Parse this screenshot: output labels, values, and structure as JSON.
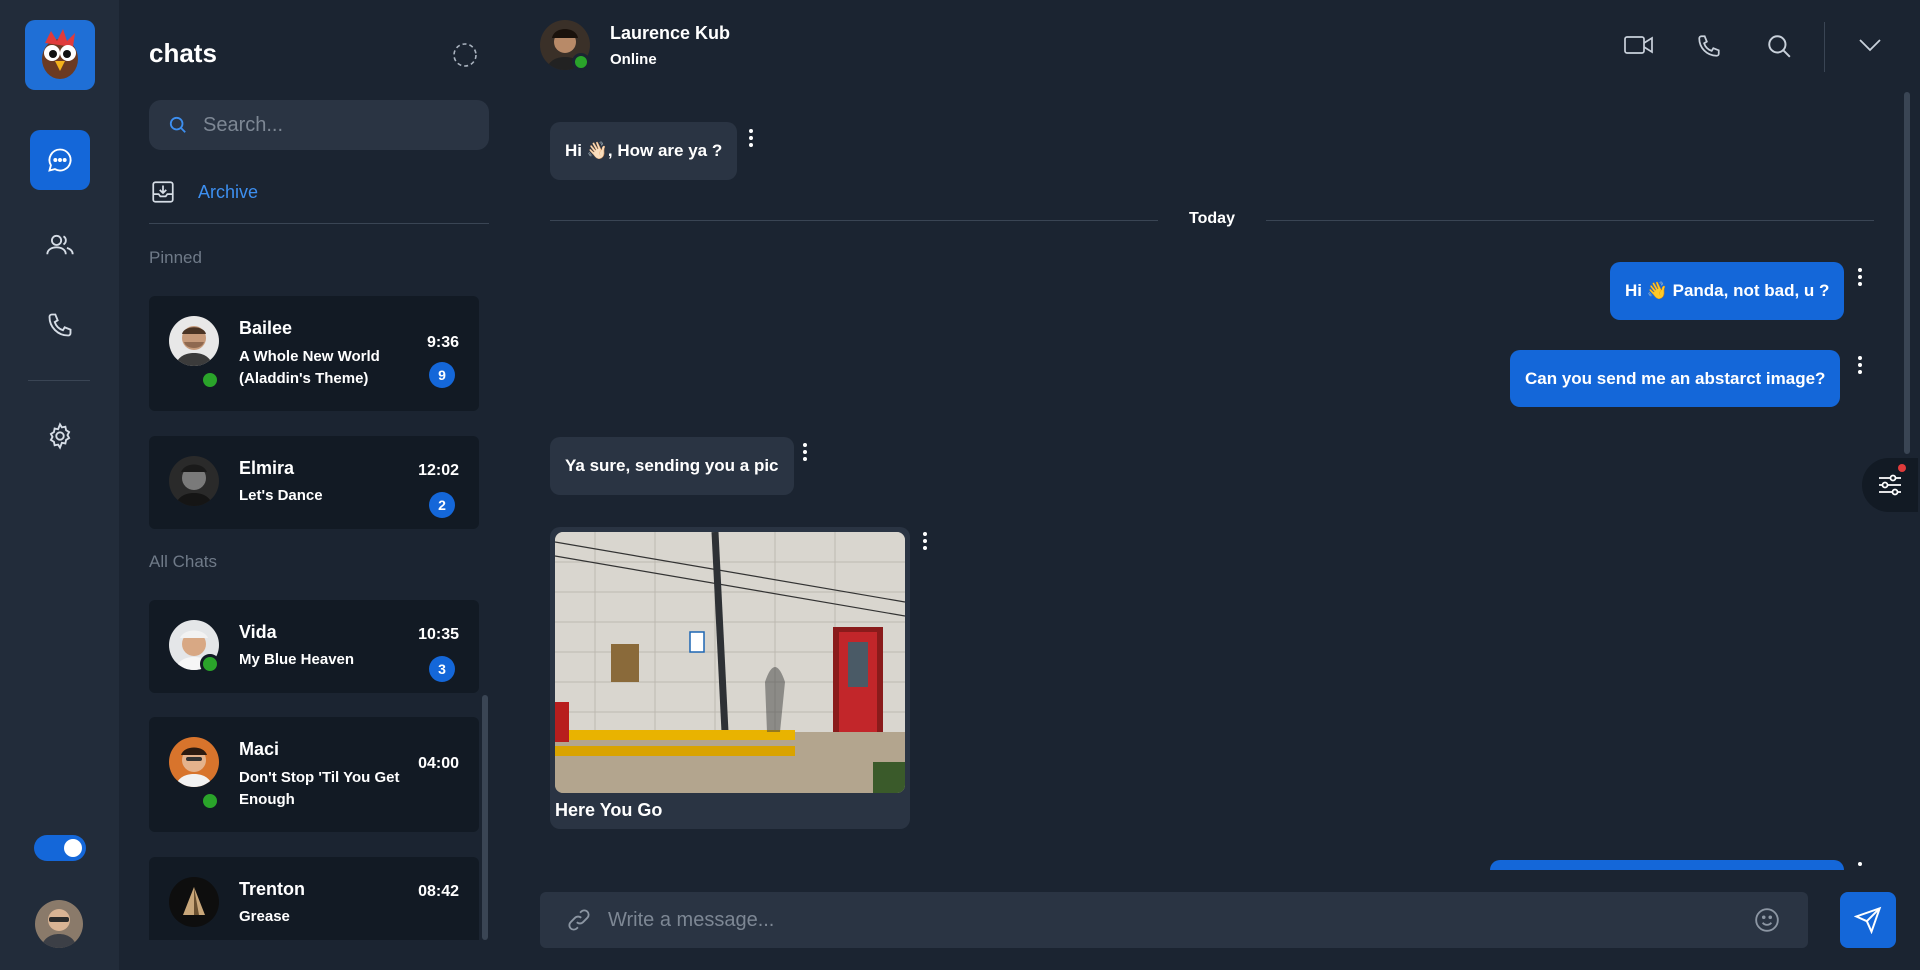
{
  "colors": {
    "background": "#1b2431",
    "rail": "#222c3a",
    "accent": "#1467d9",
    "card": "#121a24",
    "incoming_bubble": "#2a3443",
    "online": "#2aa42a",
    "link": "#3d8ff0"
  },
  "nav": {
    "logo": "parrot-logo-icon",
    "items": [
      {
        "icon": "chat-bubble-icon",
        "active": true
      },
      {
        "icon": "users-icon",
        "active": false
      },
      {
        "icon": "phone-icon",
        "active": false
      },
      {
        "icon": "gear-icon",
        "active": false
      }
    ],
    "theme_toggle_on": true
  },
  "chats": {
    "title": "chats",
    "search_placeholder": "Search...",
    "archive_label": "Archive",
    "pinned_label": "Pinned",
    "all_label": "All Chats",
    "pinned": [
      {
        "name": "Bailee",
        "message": "A Whole New World (Aladdin's Theme)",
        "time": "9:36",
        "unread": "9",
        "online": true
      },
      {
        "name": "Elmira",
        "message": "Let's Dance",
        "time": "12:02",
        "unread": "2",
        "online": false
      }
    ],
    "all": [
      {
        "name": "Vida",
        "message": "My Blue Heaven",
        "time": "10:35",
        "unread": "3",
        "online": true
      },
      {
        "name": "Maci",
        "message": "Don't Stop 'Til You Get Enough",
        "time": "04:00",
        "unread": "",
        "online": true
      },
      {
        "name": "Trenton",
        "message": "Grease",
        "time": "08:42",
        "unread": "",
        "online": false
      }
    ]
  },
  "conversation": {
    "contact_name": "Laurence Kub",
    "contact_status": "Online",
    "header_icons": [
      "video-camera-icon",
      "phone-icon",
      "search-icon",
      "chevron-down-icon"
    ],
    "divider_label": "Today",
    "messages": [
      {
        "direction": "in",
        "text": "Hi 👋🏻, How are ya ?"
      },
      {
        "direction": "out",
        "text": "Hi 👋 Panda, not bad, u ?"
      },
      {
        "direction": "out",
        "text": "Can you send me an abstarct image?"
      },
      {
        "direction": "in",
        "text": "Ya sure, sending you a pic"
      },
      {
        "direction": "in",
        "type": "image",
        "caption": "Here You Go"
      }
    ],
    "composer_placeholder": "Write a message..."
  }
}
